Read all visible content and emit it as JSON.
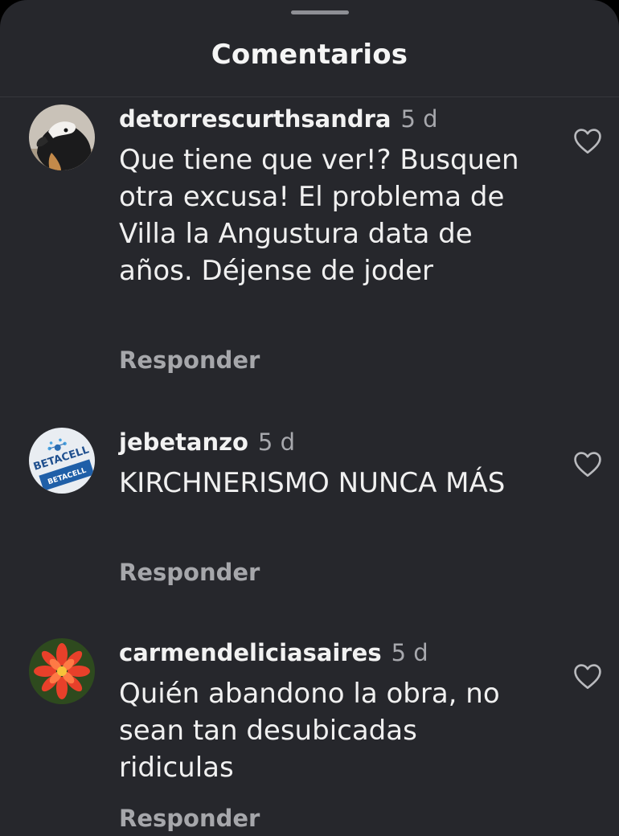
{
  "sheet": {
    "title": "Comentarios"
  },
  "comments": [
    {
      "username": "detorrescurthsandra",
      "time": "5 d",
      "text": "Que tiene que ver!? Busquen otra excusa! El problema de Villa la Angustura data de años. Déjense de joder",
      "reply": "Responder",
      "avatar_icon": "dog-avatar"
    },
    {
      "username": "jebetanzo",
      "time": "5 d",
      "text": "KIRCHNERISMO NUNCA MÁS",
      "reply": "Responder",
      "avatar_icon": "betacell-logo-avatar",
      "avatar_text": "BETACELL"
    },
    {
      "username": "carmendeliciasaires",
      "time": "5 d",
      "text": "Quién abandono la obra, no sean tan desubicadas ridiculas",
      "reply": "Responder",
      "avatar_icon": "red-flower-avatar"
    }
  ],
  "icons": {
    "like": "heart-outline-icon"
  },
  "colors": {
    "background": "#26272c",
    "primary_text": "#f0f0f0",
    "secondary_text": "#a7a8ad"
  }
}
